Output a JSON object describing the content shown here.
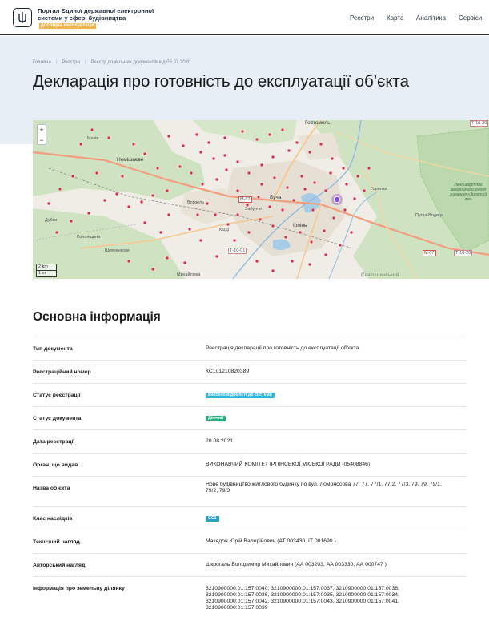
{
  "header": {
    "portal_title": "Портал Єдиної державної електронної системи у сфері будівництва",
    "beta_badge": "дослідна експлуатація",
    "nav": [
      "Реєстри",
      "Карта",
      "Аналітика",
      "Сервіси"
    ]
  },
  "breadcrumbs": [
    "Головна",
    "Реєстри",
    "Реєстр дозвільних документів від 06.07.2020"
  ],
  "page_title": "Декларація про готовність до експлуатації об’єкта",
  "map": {
    "zoom_in": "+",
    "zoom_out": "−",
    "scale_km": "2 km",
    "scale_mi": "1 mi",
    "labels": {
      "hostomel": "Гостомель",
      "nemishaieve": "Немішаєве",
      "makiv": "Маків",
      "bucha": "Буча",
      "irpin": "Ірпінь",
      "horenka": "Горенка",
      "pushcha": "Пуща-Водиця",
      "vorzel": "Ворзель",
      "kytsi": "Кіцці",
      "zabuchchia": "Забуччя",
      "mykhailivka": "Михайлівка",
      "dubky": "Дубки",
      "kolonshchyna": "Колонщина",
      "shevchenkove": "Шевченкове",
      "sviato": "Святошинський",
      "zakaznyk": "Ландшафтний заказник місцевого значення «Золотий лік»",
      "road_m07": "М-07",
      "road_m07b": "М-07",
      "road_t1001": "Т-10-01",
      "road_t1020": "Т-10-20",
      "road_t1020b": "Т-10-20"
    },
    "marker_color": "#d6324a",
    "selected_color": "#7d3fe0"
  },
  "section_title": "Основна інформація",
  "rows": [
    {
      "key": "Тип документа",
      "value": "Реєстрація декларації про готовність до експлуатації об'єкта"
    },
    {
      "key": "Реєстраційний номер",
      "value": "КС101210820389"
    },
    {
      "key": "Статус реєстрації",
      "badge": "внесено відомості до системи",
      "badge_color": "#29b6e0"
    },
    {
      "key": "Статус документа",
      "badge": "Діючий",
      "badge_color": "#22b07a"
    },
    {
      "key": "Дата реєстрації",
      "value": "20.08.2021"
    },
    {
      "key": "Орган, що видав",
      "value": "ВИКОНАВЧИЙ КОМІТЕТ ІРПІНСЬКОЇ МІСЬКОЇ РАДИ (05408846)"
    },
    {
      "key": "Назва об’єкта",
      "value": "Нове будівництво житлового будинку по вул. Ломоносова 77, 77, 77/1, 77/2, 77/3, 79, 79, 79/1, 79/2, 79/3"
    },
    {
      "key": "Клас наслідків",
      "badge": "СС1",
      "badge_color": "#2a9fc0"
    },
    {
      "key": "Технічний нагляд",
      "value": "Македон Юрій Валерійович (АТ 003430, ІТ 001690 )"
    },
    {
      "key": "Авторський нагляд",
      "value": "Шкрогаль Володимир Михайлович (АА 003203, АА 003330, АА 000747 )"
    },
    {
      "key": "Інформація про земельну ділянку",
      "value": "3210900000:01:157:0040, 3210900000:01:157:0037, 3210900000:01:157:0038, 3210900000:01:157:0036, 3210900000:01:157:0035, 3210900000:01:157:0034, 3210900000:01:157:0042, 3210900000:01:157:0043, 3210900000:01:157:0041, 3210900000:01:157:0039"
    }
  ]
}
